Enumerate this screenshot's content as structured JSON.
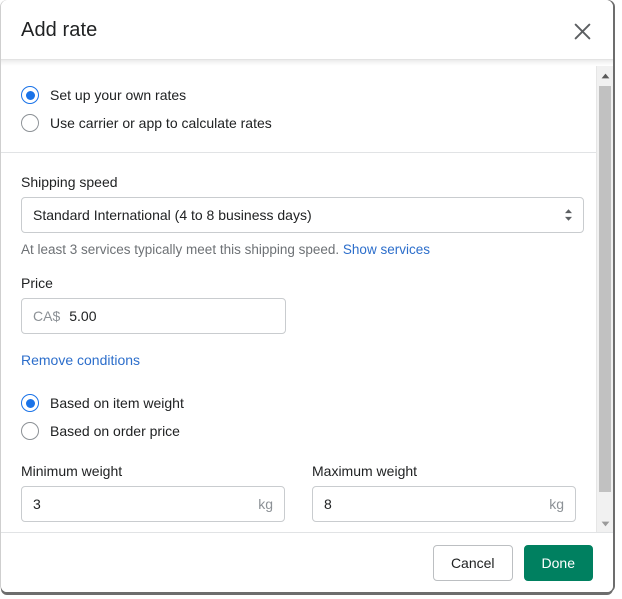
{
  "dialog": {
    "title": "Add rate",
    "close_icon": "close-icon"
  },
  "rate_type": {
    "options": [
      {
        "label": "Set up your own rates",
        "selected": true
      },
      {
        "label": "Use carrier or app to calculate rates",
        "selected": false
      }
    ]
  },
  "shipping_speed": {
    "label": "Shipping speed",
    "value": "Standard International (4 to 8 business days)",
    "helper_text": "At least 3 services typically meet this shipping speed.",
    "helper_link": "Show services",
    "select_icon": "chevron-updown-icon"
  },
  "price": {
    "label": "Price",
    "prefix": "CA$",
    "value": "5.00"
  },
  "conditions": {
    "remove_link": "Remove conditions",
    "options": [
      {
        "label": "Based on item weight",
        "selected": true
      },
      {
        "label": "Based on order price",
        "selected": false
      }
    ]
  },
  "minimum_weight": {
    "label": "Minimum weight",
    "value": "3",
    "suffix": "kg"
  },
  "maximum_weight": {
    "label": "Maximum weight",
    "value": "8",
    "suffix": "kg"
  },
  "footer": {
    "cancel_label": "Cancel",
    "done_label": "Done"
  },
  "colors": {
    "radio_accent": "#1a73e8",
    "link": "#2c6ecb",
    "primary_button": "#008060",
    "text": "#202223",
    "muted_text": "#6d7175"
  }
}
